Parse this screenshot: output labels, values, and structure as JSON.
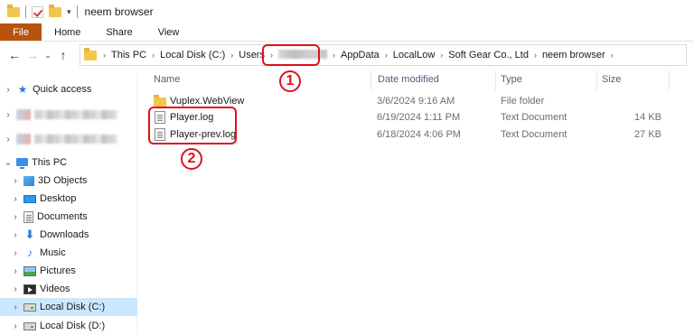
{
  "window": {
    "title": "neem browser"
  },
  "ribbon": {
    "tabs": [
      "File",
      "Home",
      "Share",
      "View"
    ]
  },
  "address": {
    "crumbs": [
      "This PC",
      "Local Disk (C:)",
      "Users",
      "",
      "AppData",
      "LocalLow",
      "Soft Gear Co., Ltd",
      "neem browser"
    ]
  },
  "nav": {
    "quick_access": "Quick access",
    "this_pc": "This PC",
    "items": [
      "3D Objects",
      "Desktop",
      "Documents",
      "Downloads",
      "Music",
      "Pictures",
      "Videos",
      "Local Disk (C:)",
      "Local Disk (D:)"
    ],
    "selected": "Local Disk (C:)"
  },
  "columns": {
    "name": "Name",
    "date": "Date modified",
    "type": "Type",
    "size": "Size"
  },
  "files": [
    {
      "name": "Vuplex.WebView",
      "date": "3/6/2024 9:16 AM",
      "type": "File folder",
      "size": "",
      "icon": "folder-icon"
    },
    {
      "name": "Player.log",
      "date": "6/19/2024 1:11 PM",
      "type": "Text Document",
      "size": "14 KB",
      "icon": "text-document-icon"
    },
    {
      "name": "Player-prev.log",
      "date": "6/18/2024 4:06 PM",
      "type": "Text Document",
      "size": "27 KB",
      "icon": "text-document-icon"
    }
  ],
  "annotations": {
    "marker_1": "1",
    "marker_2": "2",
    "color": "#e0101d"
  },
  "colors": {
    "file_tab": "#b8530f",
    "selected_row": "#cce8ff",
    "header_text": "#4c607a"
  }
}
